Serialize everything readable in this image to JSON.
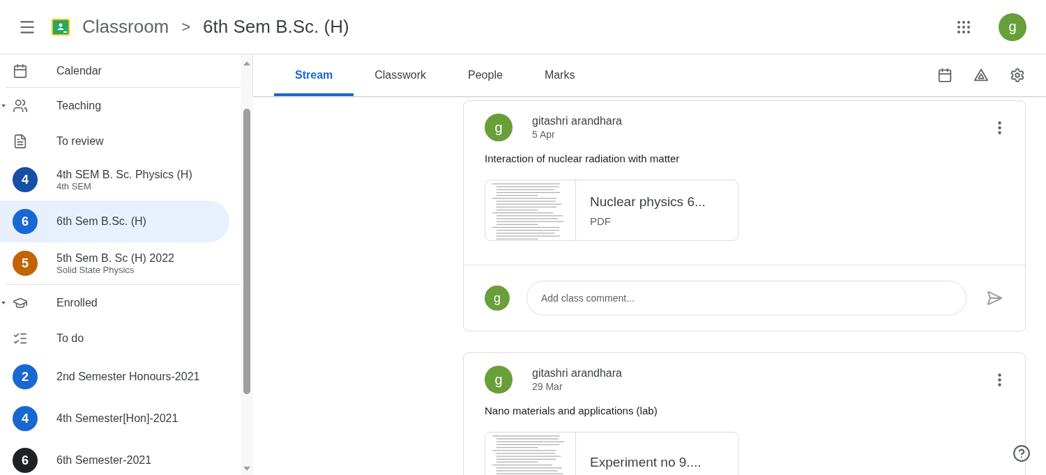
{
  "header": {
    "app_name": "Classroom",
    "separator": ">",
    "course": "6th Sem B.Sc. (H)",
    "account_letter": "g"
  },
  "sidebar": {
    "items": [
      {
        "kind": "calendar",
        "label": "Calendar"
      },
      {
        "kind": "divider"
      },
      {
        "kind": "teaching",
        "label": "Teaching",
        "expanded": true
      },
      {
        "kind": "review",
        "label": "To review"
      },
      {
        "kind": "class",
        "letter": "4",
        "color": "#174ea6",
        "label": "4th SEM B. Sc. Physics (H)",
        "sub": "4th SEM",
        "selected": false
      },
      {
        "kind": "class",
        "letter": "6",
        "color": "#1967d2",
        "label": "6th Sem B.Sc. (H)",
        "selected": true
      },
      {
        "kind": "class",
        "letter": "5",
        "color": "#c26401",
        "label": "5th Sem B. Sc (H) 2022",
        "sub": "Solid State Physics",
        "selected": false
      },
      {
        "kind": "divider"
      },
      {
        "kind": "enrolled",
        "label": "Enrolled",
        "expanded": true
      },
      {
        "kind": "todo",
        "label": "To do"
      },
      {
        "kind": "class",
        "letter": "2",
        "color": "#1967d2",
        "label": "2nd Semester Honours-2021",
        "selected": false
      },
      {
        "kind": "class",
        "letter": "4",
        "color": "#1967d2",
        "label": "4th Semester[Hon]-2021",
        "selected": false
      },
      {
        "kind": "class",
        "letter": "6",
        "color": "#202124",
        "label": "6th Semester-2021",
        "selected": false
      }
    ]
  },
  "tabs": [
    {
      "label": "Stream",
      "selected": true
    },
    {
      "label": "Classwork",
      "selected": false
    },
    {
      "label": "People",
      "selected": false
    },
    {
      "label": "Marks",
      "selected": false
    }
  ],
  "posts": [
    {
      "avatar_letter": "g",
      "author": "gitashri arandhara",
      "date": "5 Apr",
      "text": "Interaction of nuclear radiation with matter",
      "attachment": {
        "title": "Nuclear physics 6...",
        "type": "PDF"
      },
      "comment": {
        "avatar_letter": "g",
        "placeholder": "Add class comment..."
      }
    },
    {
      "avatar_letter": "g",
      "author": "gitashri arandhara",
      "date": "29 Mar",
      "text": "Nano materials and applications (lab)",
      "attachment": {
        "title": "Experiment no 9...."
      }
    }
  ]
}
